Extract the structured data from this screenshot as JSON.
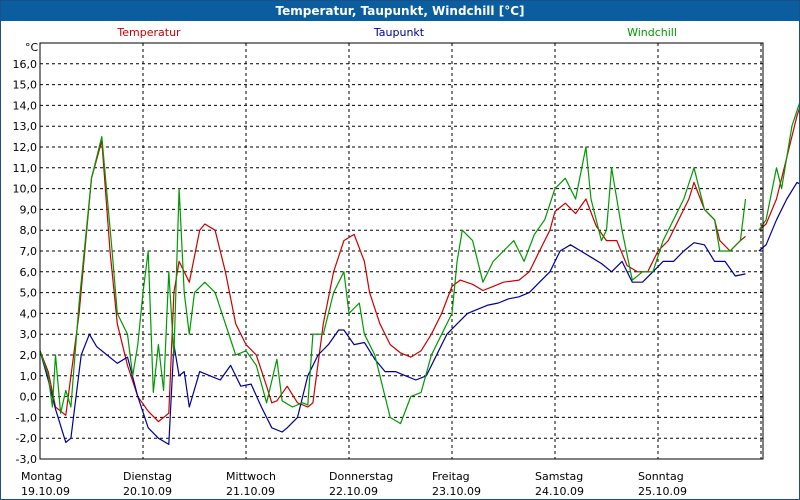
{
  "window": {
    "title": "Temperatur, Taupunkt, Windchill [°C]"
  },
  "chart_data": {
    "type": "line",
    "title": "Temperatur, Taupunkt, Windchill [°C]",
    "ylabel": "°C",
    "ylim": [
      -3,
      17
    ],
    "yticks": [
      "-3,0",
      "-2,0",
      "-1,0",
      "0,0",
      "1,0",
      "2,0",
      "3,0",
      "4,0",
      "5,0",
      "6,0",
      "7,0",
      "8,0",
      "9,0",
      "10,0",
      "11,0",
      "12,0",
      "13,0",
      "14,0",
      "15,0",
      "16,0"
    ],
    "xlim": [
      0,
      7
    ],
    "days": [
      {
        "name": "Montag",
        "date": "19.10.09"
      },
      {
        "name": "Dienstag",
        "date": "20.10.09"
      },
      {
        "name": "Mittwoch",
        "date": "21.10.09"
      },
      {
        "name": "Donnerstag",
        "date": "22.10.09"
      },
      {
        "name": "Freitag",
        "date": "23.10.09"
      },
      {
        "name": "Samstag",
        "date": "24.10.09"
      },
      {
        "name": "Sonntag",
        "date": "25.10.09"
      }
    ],
    "grid": true,
    "legend_position": "top",
    "series": [
      {
        "name": "Temperatur",
        "color": "#cc0000",
        "points": [
          [
            0,
            2.2
          ],
          [
            0.08,
            1.2
          ],
          [
            0.15,
            -0.5
          ],
          [
            0.25,
            -0.9
          ],
          [
            0.38,
            4
          ],
          [
            0.5,
            10.5
          ],
          [
            0.6,
            12.3
          ],
          [
            0.68,
            7
          ],
          [
            0.75,
            3.5
          ],
          [
            0.85,
            1.5
          ],
          [
            0.95,
            0
          ],
          [
            1.05,
            -0.7
          ],
          [
            1.15,
            -1.2
          ],
          [
            1.25,
            -0.8
          ],
          [
            1.3,
            5
          ],
          [
            1.35,
            6.5
          ],
          [
            1.45,
            5.5
          ],
          [
            1.55,
            8
          ],
          [
            1.6,
            8.3
          ],
          [
            1.7,
            8
          ],
          [
            1.8,
            6
          ],
          [
            1.9,
            3.5
          ],
          [
            2.0,
            2.5
          ],
          [
            2.1,
            2
          ],
          [
            2.2,
            0.5
          ],
          [
            2.25,
            -0.3
          ],
          [
            2.3,
            -0.2
          ],
          [
            2.4,
            0.5
          ],
          [
            2.5,
            -0.3
          ],
          [
            2.6,
            -0.5
          ],
          [
            2.65,
            -0.3
          ],
          [
            2.75,
            3.5
          ],
          [
            2.85,
            6
          ],
          [
            2.95,
            7.5
          ],
          [
            3.05,
            7.8
          ],
          [
            3.15,
            6.5
          ],
          [
            3.2,
            5
          ],
          [
            3.3,
            3.5
          ],
          [
            3.4,
            2.5
          ],
          [
            3.5,
            2.1
          ],
          [
            3.6,
            1.9
          ],
          [
            3.7,
            2.2
          ],
          [
            3.8,
            3
          ],
          [
            3.9,
            4
          ],
          [
            4.0,
            5.3
          ],
          [
            4.08,
            5.6
          ],
          [
            4.2,
            5.4
          ],
          [
            4.3,
            5.1
          ],
          [
            4.4,
            5.3
          ],
          [
            4.5,
            5.5
          ],
          [
            4.65,
            5.6
          ],
          [
            4.75,
            6
          ],
          [
            4.85,
            7
          ],
          [
            4.95,
            8
          ],
          [
            5.0,
            8.9
          ],
          [
            5.1,
            9.3
          ],
          [
            5.2,
            8.8
          ],
          [
            5.3,
            9.5
          ],
          [
            5.4,
            8.2
          ],
          [
            5.5,
            7.5
          ],
          [
            5.6,
            7.5
          ],
          [
            5.7,
            6.3
          ],
          [
            5.8,
            6
          ],
          [
            5.9,
            6
          ],
          [
            6.0,
            7
          ],
          [
            6.1,
            7.5
          ],
          [
            6.2,
            8.5
          ],
          [
            6.3,
            9.5
          ],
          [
            6.35,
            10.3
          ],
          [
            6.45,
            9
          ],
          [
            6.55,
            8.5
          ],
          [
            6.6,
            7.5
          ],
          [
            6.7,
            7
          ],
          [
            6.8,
            7.5
          ],
          [
            6.85,
            7.7
          ],
          null,
          [
            6.98,
            8
          ],
          [
            7.05,
            8.3
          ],
          [
            7.15,
            9.5
          ],
          [
            7.25,
            11.5
          ],
          [
            7.35,
            13.5
          ],
          [
            7.45,
            15
          ],
          [
            7.55,
            15.7
          ],
          [
            7.6,
            15
          ],
          [
            7.65,
            12
          ],
          [
            7.7,
            10
          ],
          [
            7.75,
            8.5
          ],
          [
            7.8,
            8.8
          ],
          [
            7.85,
            8.9
          ],
          [
            7.93,
            7.8
          ]
        ]
      },
      {
        "name": "Taupunkt",
        "color": "#000099",
        "points": [
          [
            0,
            2.2
          ],
          [
            0.08,
            0.8
          ],
          [
            0.15,
            -0.6
          ],
          [
            0.25,
            -2.2
          ],
          [
            0.3,
            -2
          ],
          [
            0.4,
            2
          ],
          [
            0.48,
            3
          ],
          [
            0.55,
            2.4
          ],
          [
            0.65,
            2
          ],
          [
            0.75,
            1.6
          ],
          [
            0.85,
            1.9
          ],
          [
            0.95,
            0
          ],
          [
            1.05,
            -1.5
          ],
          [
            1.15,
            -2
          ],
          [
            1.25,
            -2.3
          ],
          [
            1.3,
            2.5
          ],
          [
            1.35,
            1
          ],
          [
            1.4,
            1.2
          ],
          [
            1.45,
            -0.5
          ],
          [
            1.55,
            1.2
          ],
          [
            1.65,
            1
          ],
          [
            1.75,
            0.8
          ],
          [
            1.85,
            1.5
          ],
          [
            1.95,
            0.5
          ],
          [
            2.05,
            0.6
          ],
          [
            2.15,
            -0.5
          ],
          [
            2.25,
            -1.5
          ],
          [
            2.35,
            -1.7
          ],
          [
            2.4,
            -1.5
          ],
          [
            2.5,
            -1
          ],
          [
            2.6,
            1
          ],
          [
            2.7,
            2
          ],
          [
            2.8,
            2.5
          ],
          [
            2.9,
            3.2
          ],
          [
            2.95,
            3.2
          ],
          [
            3.05,
            2.5
          ],
          [
            3.15,
            2.6
          ],
          [
            3.25,
            1.8
          ],
          [
            3.35,
            1.2
          ],
          [
            3.45,
            1.2
          ],
          [
            3.55,
            1
          ],
          [
            3.65,
            0.8
          ],
          [
            3.75,
            1
          ],
          [
            3.85,
            2
          ],
          [
            3.95,
            3
          ],
          [
            4.05,
            3.5
          ],
          [
            4.15,
            4
          ],
          [
            4.25,
            4.2
          ],
          [
            4.35,
            4.4
          ],
          [
            4.45,
            4.5
          ],
          [
            4.55,
            4.7
          ],
          [
            4.65,
            4.8
          ],
          [
            4.75,
            5
          ],
          [
            4.85,
            5.5
          ],
          [
            4.95,
            6
          ],
          [
            5.05,
            7
          ],
          [
            5.15,
            7.3
          ],
          [
            5.25,
            7
          ],
          [
            5.35,
            6.7
          ],
          [
            5.45,
            6.4
          ],
          [
            5.55,
            6
          ],
          [
            5.65,
            6.5
          ],
          [
            5.75,
            5.5
          ],
          [
            5.85,
            5.5
          ],
          [
            5.95,
            6
          ],
          [
            6.05,
            6.5
          ],
          [
            6.15,
            6.5
          ],
          [
            6.25,
            7
          ],
          [
            6.35,
            7.4
          ],
          [
            6.45,
            7.3
          ],
          [
            6.55,
            6.5
          ],
          [
            6.65,
            6.5
          ],
          [
            6.75,
            5.8
          ],
          [
            6.85,
            5.9
          ],
          null,
          [
            6.98,
            7
          ],
          [
            7.05,
            7.3
          ],
          [
            7.15,
            8.5
          ],
          [
            7.25,
            9.5
          ],
          [
            7.35,
            10.3
          ],
          [
            7.45,
            10
          ],
          [
            7.55,
            9
          ],
          [
            7.65,
            8
          ],
          [
            7.75,
            7
          ],
          [
            7.85,
            7.2
          ],
          [
            7.93,
            6.4
          ]
        ]
      },
      {
        "name": "Windchill",
        "color": "#009900",
        "points": [
          [
            0,
            2.2
          ],
          [
            0.08,
            1
          ],
          [
            0.12,
            -0.5
          ],
          [
            0.15,
            2
          ],
          [
            0.2,
            -0.8
          ],
          [
            0.25,
            0.3
          ],
          [
            0.3,
            -0.5
          ],
          [
            0.38,
            4.5
          ],
          [
            0.5,
            10.5
          ],
          [
            0.6,
            12.5
          ],
          [
            0.7,
            7
          ],
          [
            0.75,
            4
          ],
          [
            0.85,
            3
          ],
          [
            0.9,
            1
          ],
          [
            0.95,
            2.5
          ],
          [
            1.0,
            5
          ],
          [
            1.05,
            7
          ],
          [
            1.1,
            0.2
          ],
          [
            1.15,
            2.5
          ],
          [
            1.2,
            0.3
          ],
          [
            1.25,
            6
          ],
          [
            1.3,
            2
          ],
          [
            1.35,
            10
          ],
          [
            1.4,
            5
          ],
          [
            1.45,
            3
          ],
          [
            1.5,
            5
          ],
          [
            1.6,
            5.5
          ],
          [
            1.7,
            5
          ],
          [
            1.8,
            3.5
          ],
          [
            1.9,
            2
          ],
          [
            2.0,
            2.2
          ],
          [
            2.1,
            1.5
          ],
          [
            2.2,
            -0.3
          ],
          [
            2.3,
            1.8
          ],
          [
            2.35,
            -0.2
          ],
          [
            2.45,
            -0.5
          ],
          [
            2.55,
            -0.3
          ],
          [
            2.6,
            -0.4
          ],
          [
            2.65,
            3
          ],
          [
            2.75,
            3
          ],
          [
            2.85,
            5
          ],
          [
            2.95,
            6
          ],
          [
            3.0,
            4
          ],
          [
            3.1,
            4.5
          ],
          [
            3.15,
            3
          ],
          [
            3.25,
            2
          ],
          [
            3.3,
            1
          ],
          [
            3.4,
            -1
          ],
          [
            3.5,
            -1.3
          ],
          [
            3.6,
            0
          ],
          [
            3.7,
            0.2
          ],
          [
            3.8,
            2
          ],
          [
            3.9,
            3
          ],
          [
            4.0,
            4
          ],
          [
            4.05,
            6.5
          ],
          [
            4.1,
            8
          ],
          [
            4.2,
            7.5
          ],
          [
            4.3,
            5.5
          ],
          [
            4.4,
            6.5
          ],
          [
            4.5,
            7
          ],
          [
            4.6,
            7.5
          ],
          [
            4.7,
            6.5
          ],
          [
            4.8,
            7.8
          ],
          [
            4.9,
            8.5
          ],
          [
            5.0,
            10
          ],
          [
            5.1,
            10.5
          ],
          [
            5.2,
            9.5
          ],
          [
            5.3,
            12
          ],
          [
            5.35,
            9.5
          ],
          [
            5.45,
            7.5
          ],
          [
            5.5,
            8
          ],
          [
            5.55,
            11
          ],
          [
            5.65,
            8
          ],
          [
            5.75,
            5.6
          ],
          [
            5.85,
            6
          ],
          [
            5.95,
            6
          ],
          [
            6.05,
            7.5
          ],
          [
            6.15,
            8.5
          ],
          [
            6.25,
            9.5
          ],
          [
            6.35,
            11
          ],
          [
            6.45,
            9
          ],
          [
            6.55,
            8.5
          ],
          [
            6.6,
            7
          ],
          [
            6.7,
            7
          ],
          [
            6.8,
            7.5
          ],
          [
            6.85,
            9.5
          ],
          null,
          [
            6.98,
            8
          ],
          [
            7.05,
            8.5
          ],
          [
            7.15,
            11
          ],
          [
            7.2,
            10
          ],
          [
            7.3,
            13
          ],
          [
            7.4,
            14.5
          ],
          [
            7.5,
            16
          ],
          [
            7.6,
            16.5
          ],
          [
            7.65,
            12
          ],
          [
            7.7,
            10
          ],
          [
            7.8,
            9.5
          ],
          [
            7.85,
            9
          ],
          [
            7.93,
            7.8
          ]
        ]
      }
    ]
  }
}
